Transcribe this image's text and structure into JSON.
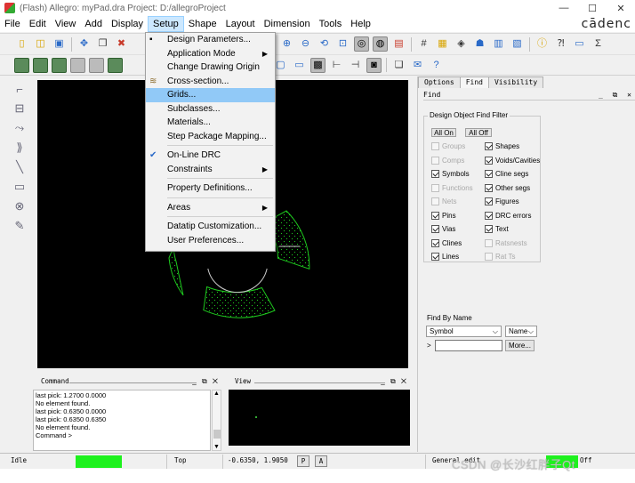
{
  "window": {
    "title": "(Flash) Allegro: myPad.dra  Project: D:/allegroProject",
    "controls": [
      "—",
      "☐",
      "✕"
    ]
  },
  "menubar": {
    "items": [
      "File",
      "Edit",
      "View",
      "Add",
      "Display",
      "Setup",
      "Shape",
      "Layout",
      "Dimension",
      "Tools",
      "Help"
    ],
    "active": "Setup",
    "brand": "cādenc"
  },
  "setup_menu": {
    "items": [
      {
        "label": "Design Parameters...",
        "icon": "design-params-icon"
      },
      {
        "label": "Application Mode",
        "submenu": true
      },
      {
        "label": "Change Drawing Origin"
      },
      {
        "label": "Cross-section...",
        "icon": "cross-section-icon"
      },
      {
        "label": "Grids...",
        "highlighted": true
      },
      {
        "label": "Subclasses..."
      },
      {
        "label": "Materials..."
      },
      {
        "label": "Step Package Mapping..."
      },
      {
        "separator": true
      },
      {
        "label": "On-Line DRC",
        "checked": true
      },
      {
        "label": "Constraints",
        "submenu": true
      },
      {
        "separator": true
      },
      {
        "label": "Property Definitions..."
      },
      {
        "separator": true
      },
      {
        "label": "Areas",
        "submenu": true
      },
      {
        "separator": true
      },
      {
        "label": "Datatip Customization..."
      },
      {
        "label": "User Preferences..."
      }
    ],
    "highlight_color": "#91c9f7"
  },
  "right_panel": {
    "tabs": [
      "Options",
      "Find",
      "Visibility"
    ],
    "active_tab": "Find",
    "header": "Find",
    "header_controls": [
      "_",
      "⧉",
      "✕"
    ],
    "find_filter": {
      "title": "Design Object Find Filter",
      "all_on": "All On",
      "all_off": "All Off",
      "left_items": [
        {
          "label": "Groups",
          "checked": false,
          "enabled": false
        },
        {
          "label": "Comps",
          "checked": false,
          "enabled": false
        },
        {
          "label": "Symbols",
          "checked": true,
          "enabled": true
        },
        {
          "label": "Functions",
          "checked": false,
          "enabled": false
        },
        {
          "label": "Nets",
          "checked": false,
          "enabled": false
        },
        {
          "label": "Pins",
          "checked": true,
          "enabled": true
        },
        {
          "label": "Vias",
          "checked": true,
          "enabled": true
        },
        {
          "label": "Clines",
          "checked": true,
          "enabled": true
        },
        {
          "label": "Lines",
          "checked": true,
          "enabled": true
        }
      ],
      "right_items": [
        {
          "label": "Shapes",
          "checked": true,
          "enabled": true
        },
        {
          "label": "Voids/Cavities",
          "checked": true,
          "enabled": true
        },
        {
          "label": "Cline segs",
          "checked": true,
          "enabled": true
        },
        {
          "label": "Other segs",
          "checked": true,
          "enabled": true
        },
        {
          "label": "Figures",
          "checked": true,
          "enabled": true
        },
        {
          "label": "DRC errors",
          "checked": true,
          "enabled": true
        },
        {
          "label": "Text",
          "checked": true,
          "enabled": true
        },
        {
          "label": "Ratsnests",
          "checked": false,
          "enabled": false
        },
        {
          "label": "Rat Ts",
          "checked": false,
          "enabled": false
        }
      ]
    },
    "find_by_name": {
      "title": "Find By Name",
      "type_value": "Symbol",
      "mode_value": "Name",
      "prompt": ">",
      "input_value": "",
      "more_label": "More..."
    }
  },
  "command_window": {
    "title": "Command",
    "controls": [
      "_",
      "⧉",
      "✕"
    ],
    "lines": [
      "last pick:  1.2700 0.0000",
      "No element found.",
      "last pick:  0.6350 0.0000",
      "last pick:  0.6350 0.6350",
      "No element found.",
      "Command >"
    ]
  },
  "view_window": {
    "title": "View",
    "controls": [
      "_",
      "⧉",
      "✕"
    ]
  },
  "statusbar": {
    "state": "Idle",
    "layer": "Top",
    "coords": "-0.6350, 1.9050",
    "p_btn": "P",
    "a_btn": "A",
    "mode": "General edit",
    "drc": "Off",
    "indicator_color": "#1ef11e"
  },
  "watermark": "CSDN @长沙红胖子Qt",
  "canvas": {
    "background": "#000000",
    "shape_color": "#1ec81e",
    "crosshair_color": "#c8c8c8"
  }
}
